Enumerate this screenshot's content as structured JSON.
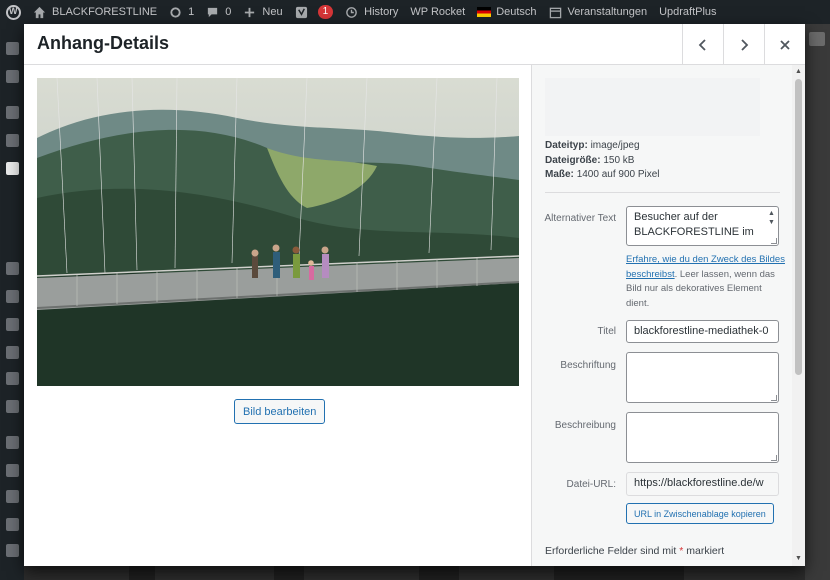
{
  "adminbar": {
    "site_name": "BLACKFORESTLINE",
    "updates_count": "1",
    "comments_count": "0",
    "new_label": "Neu",
    "yoast_badge": "1",
    "history_label": "History",
    "wprocket_label": "WP Rocket",
    "language_label": "Deutsch",
    "events_label": "Veranstaltungen",
    "updraft_label": "UpdraftPlus"
  },
  "modal": {
    "title": "Anhang-Details",
    "prev_icon": "chevron-left",
    "next_icon": "chevron-right",
    "close_icon": "close"
  },
  "image": {
    "edit_button": "Bild bearbeiten"
  },
  "details": {
    "filetype_label": "Dateityp:",
    "filetype_value": "image/jpeg",
    "filesize_label": "Dateigröße:",
    "filesize_value": "150 kB",
    "dimensions_label": "Maße:",
    "dimensions_value": "1400 auf 900 Pixel"
  },
  "fields": {
    "alt_label": "Alternativer Text",
    "alt_value": "Besucher auf der BLACKFORESTLINE im",
    "alt_help_link": "Erfahre, wie du den Zweck des Bildes beschreibst",
    "alt_help_text": ". Leer lassen, wenn das Bild nur als dekoratives Element dient.",
    "title_label": "Titel",
    "title_value": "blackforestline-mediathek-0",
    "caption_label": "Beschriftung",
    "caption_value": "",
    "description_label": "Beschreibung",
    "description_value": "",
    "url_label": "Datei-URL:",
    "url_value": "https://blackforestline.de/w",
    "copy_url_button": "URL in Zwischenablage kopieren",
    "required_text": "Erforderliche Felder sind mit",
    "required_star": "*",
    "required_suffix": "markiert"
  },
  "colors": {
    "accent": "#2271b1",
    "danger": "#d63638",
    "adminbar_bg": "#1d2327"
  }
}
